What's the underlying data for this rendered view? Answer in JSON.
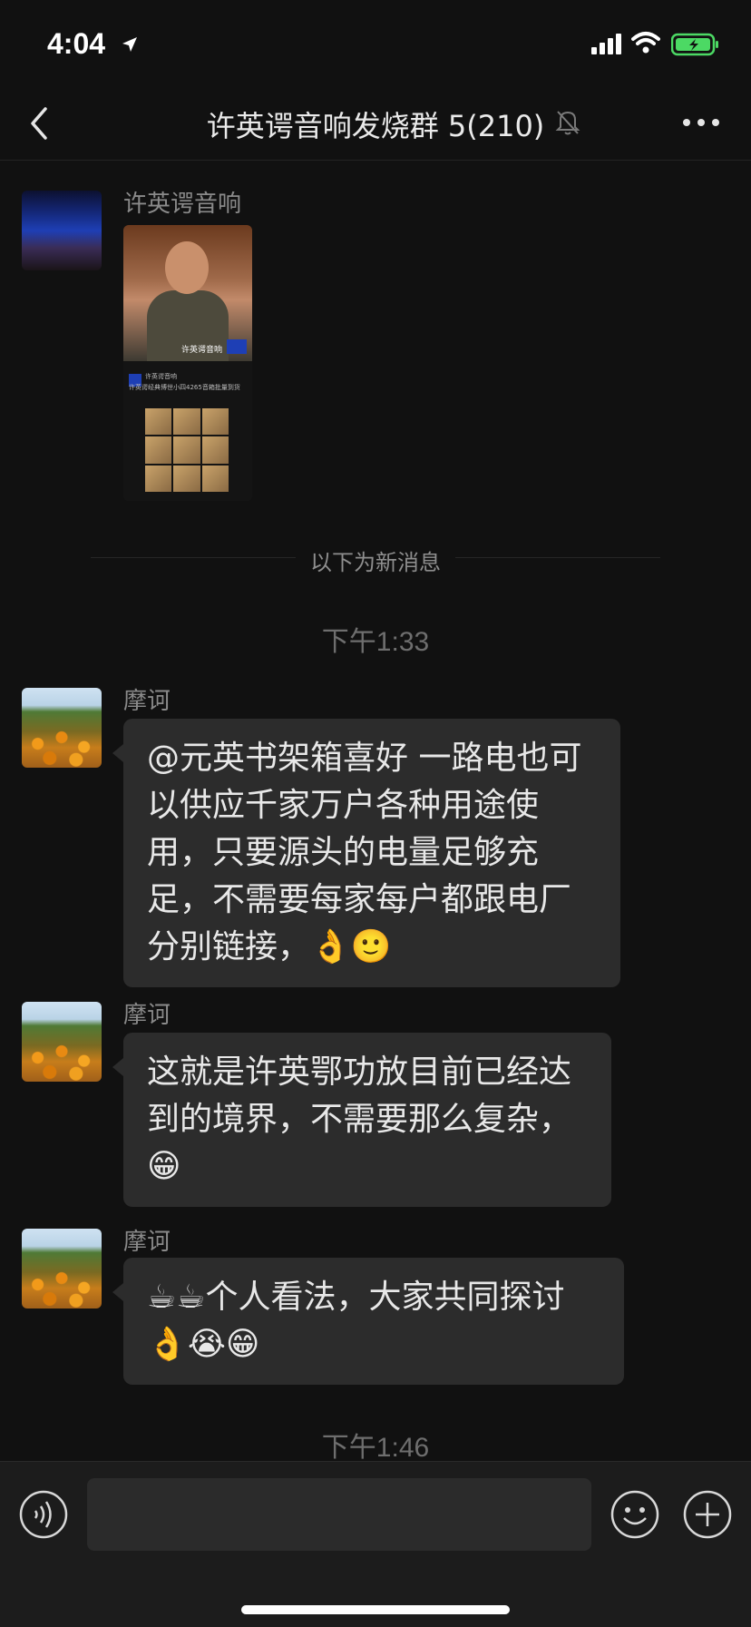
{
  "status_bar": {
    "time": "4:04"
  },
  "nav": {
    "title": "许英谔音响发烧群 5(210)"
  },
  "first_message": {
    "sender": "许英谔音响",
    "image_caption": "许英谔音响",
    "image_text_1": "许英谔音响",
    "image_text_2": "许英谔经典博世小四4265音箱批量到货"
  },
  "new_messages_label": "以下为新消息",
  "timestamps": [
    "下午1:33",
    "下午1:46"
  ],
  "messages": [
    {
      "sender": "摩诃",
      "text": "@元英书架箱喜好 一路电也可以供应千家万户各种用途使用，只要源头的电量足够充足，不需要每家每户都跟电厂分别链接，👌🙂"
    },
    {
      "sender": "摩诃",
      "text": "这就是许英鄂功放目前已经达到的境界，不需要那么复杂，😁"
    },
    {
      "sender": "摩诃",
      "text": "☕☕个人看法，大家共同探讨👌😭😁"
    }
  ],
  "input": {
    "placeholder": ""
  },
  "colors": {
    "background": "#111111",
    "bubble": "#2c2c2c",
    "battery": "#4cd964"
  }
}
